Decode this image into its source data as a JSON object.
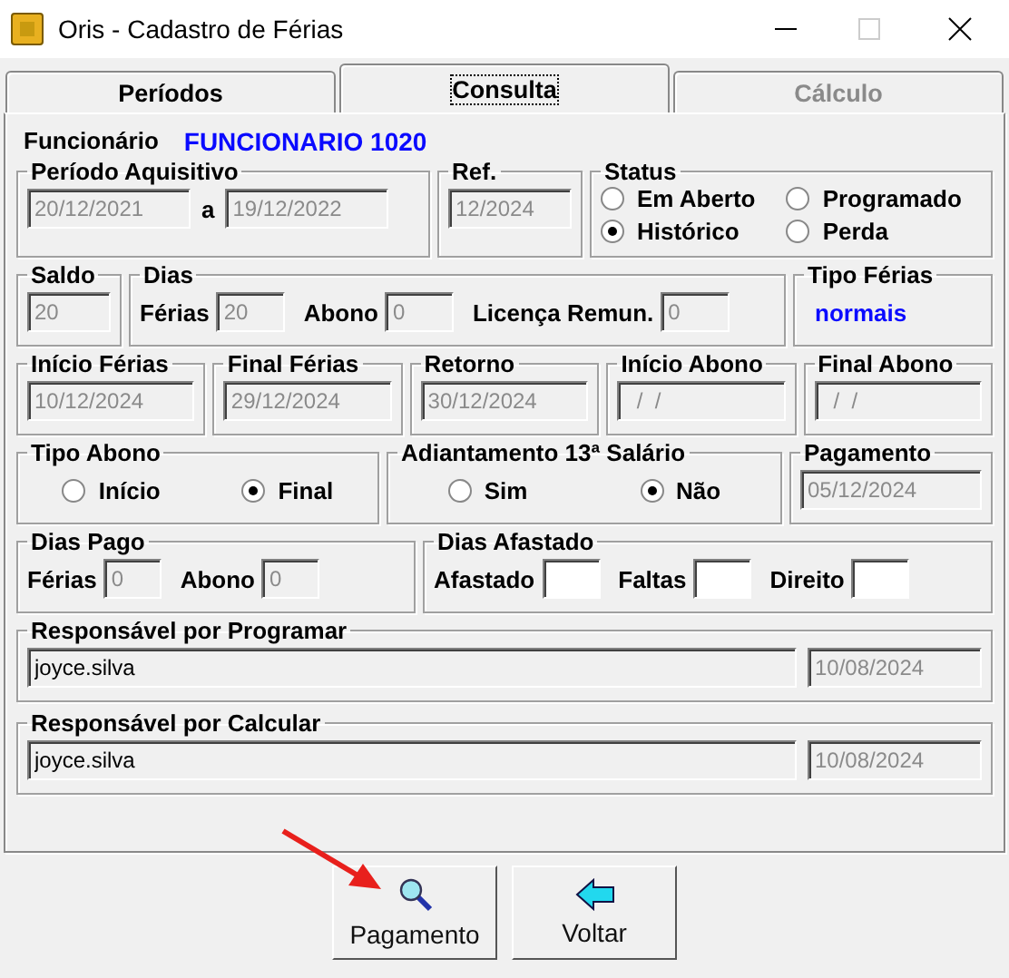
{
  "window": {
    "title": "Oris - Cadastro de Férias"
  },
  "tabs": [
    {
      "label": "Períodos",
      "selected": false,
      "disabled": false
    },
    {
      "label": "Consulta",
      "selected": true,
      "disabled": false
    },
    {
      "label": "Cálculo",
      "selected": false,
      "disabled": true
    }
  ],
  "employee": {
    "label": "Funcionário",
    "value": "FUNCIONARIO 1020"
  },
  "periodo": {
    "legend": "Período Aquisitivo",
    "from": "20/12/2021",
    "separator": "a",
    "to": "19/12/2022"
  },
  "ref": {
    "legend": "Ref.",
    "value": "12/2024"
  },
  "status": {
    "legend": "Status",
    "options": [
      {
        "label": "Em Aberto",
        "selected": false
      },
      {
        "label": "Programado",
        "selected": false
      },
      {
        "label": "Histórico",
        "selected": true
      },
      {
        "label": "Perda",
        "selected": false
      }
    ]
  },
  "saldo": {
    "legend": "Saldo",
    "value": "20"
  },
  "dias": {
    "legend": "Dias",
    "fields": [
      {
        "label": "Férias",
        "value": "20"
      },
      {
        "label": "Abono",
        "value": "0"
      },
      {
        "label": "Licença Remun.",
        "value": "0"
      }
    ]
  },
  "tipo_ferias": {
    "legend": "Tipo Férias",
    "value": "normais"
  },
  "dates": [
    {
      "legend": "Início Férias",
      "value": "10/12/2024"
    },
    {
      "legend": "Final Férias",
      "value": "29/12/2024"
    },
    {
      "legend": "Retorno",
      "value": "30/12/2024"
    },
    {
      "legend": "Início Abono",
      "value": "  /  /"
    },
    {
      "legend": "Final Abono",
      "value": "  /  /"
    }
  ],
  "tipo_abono": {
    "legend": "Tipo Abono",
    "options": [
      {
        "label": "Início",
        "selected": false
      },
      {
        "label": "Final",
        "selected": true
      }
    ]
  },
  "adiantamento": {
    "legend": "Adiantamento 13ª Salário",
    "options": [
      {
        "label": "Sim",
        "selected": false
      },
      {
        "label": "Não",
        "selected": true
      }
    ]
  },
  "pagamento": {
    "legend": "Pagamento",
    "value": "05/12/2024"
  },
  "dias_pago": {
    "legend": "Dias Pago",
    "fields": [
      {
        "label": "Férias",
        "value": "0"
      },
      {
        "label": "Abono",
        "value": "0"
      }
    ]
  },
  "dias_afastado": {
    "legend": "Dias Afastado",
    "fields": [
      {
        "label": "Afastado"
      },
      {
        "label": "Faltas"
      },
      {
        "label": "Direito"
      }
    ]
  },
  "responsaveis": [
    {
      "legend": "Responsável por Programar",
      "name": "joyce.silva",
      "date": "10/08/2024"
    },
    {
      "legend": "Responsável por Calcular",
      "name": "joyce.silva",
      "date": "10/08/2024"
    }
  ],
  "buttons": [
    {
      "label": "Pagamento",
      "kind": "search"
    },
    {
      "label": "Voltar",
      "kind": "back"
    }
  ]
}
